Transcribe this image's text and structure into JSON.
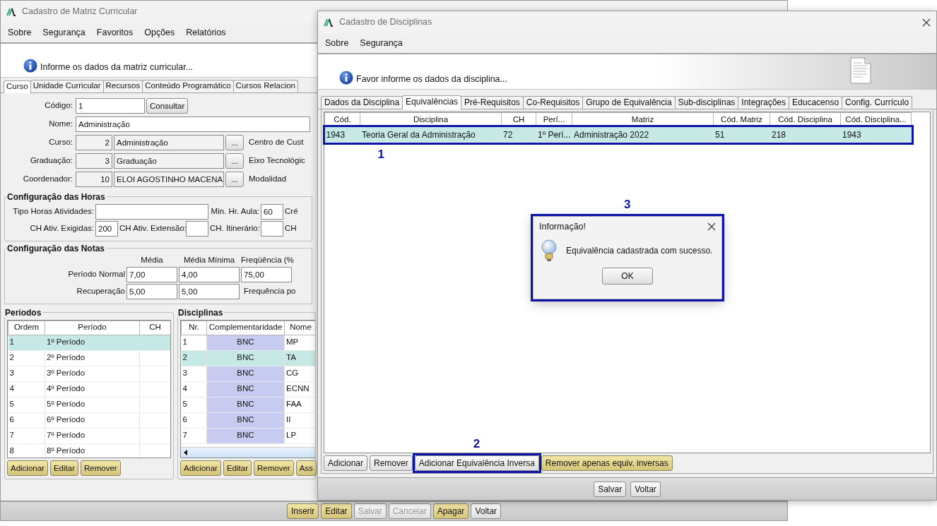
{
  "curriculum_window": {
    "title": "Cadastro de Matriz Curricular",
    "menu": [
      {
        "label": "Sobre"
      },
      {
        "label": "Segurança"
      },
      {
        "label": "Favoritos"
      },
      {
        "label": "Opções"
      },
      {
        "label": "Relatórios"
      }
    ],
    "info_message": "Informe os dados da matriz curricular...",
    "tabs": [
      {
        "label": "Curso",
        "selected": true
      },
      {
        "label": "Unidade Curricular",
        "selected": false
      },
      {
        "label": "Recursos",
        "selected": false
      },
      {
        "label": "Conteúdo Programático",
        "selected": false
      },
      {
        "label": "Cursos Relacion",
        "selected": false
      }
    ],
    "fields": [
      {
        "kind": "code",
        "label": "Código:",
        "value": "1",
        "button": {
          "label": "Consultar",
          "kind": "plain"
        }
      },
      {
        "kind": "text",
        "label": "Nome:",
        "value": "Administração"
      },
      {
        "kind": "lookup",
        "label": "Curso:",
        "code": "2",
        "value": "Administração",
        "button": {
          "label": "...",
          "kind": "plain"
        },
        "side_label": "Centro de Cust"
      },
      {
        "kind": "lookup",
        "label": "Graduação:",
        "code": "3",
        "value": "Graduação",
        "button": {
          "label": "...",
          "kind": "plain"
        },
        "side_label": "Eixo Tecnológic"
      },
      {
        "kind": "lookup",
        "label": "Coordenador:",
        "code": "10",
        "value": "ELOI AGOSTINHO MACENA",
        "button": {
          "label": "...",
          "kind": "plain"
        },
        "side_label": "Modalidad"
      }
    ],
    "hours": {
      "title": "Configuração das Horas",
      "items": [
        {
          "kind": "wide_field",
          "label": "Tipo Horas Atividades:"
        },
        {
          "kind": "field",
          "label": "Min. Hr. Aula:",
          "value": "60"
        },
        {
          "kind": "label",
          "label": "Cré"
        },
        {
          "kind": "field",
          "label": "CH Ativ. Exigidas:",
          "value": "200"
        },
        {
          "kind": "field",
          "label": "CH Ativ. Extensão:"
        },
        {
          "kind": "field",
          "label": "CH. Itinerário:"
        },
        {
          "kind": "label",
          "label": "CH"
        }
      ]
    },
    "grades": {
      "title": "Configuração das Notas",
      "columns": [
        "Média",
        "Média Mínima",
        "Freqüência (%"
      ],
      "rows": [
        {
          "label": "Período Normal",
          "values": [
            "7,00",
            "4,00",
            "75,00"
          ]
        },
        {
          "label": "Recuperação",
          "values": [
            "5,00",
            "5,00"
          ],
          "note": "Frequência po"
        }
      ]
    },
    "periods": {
      "title": "Períodos",
      "columns": [
        "Ordem",
        "Período",
        "CH"
      ],
      "rows": [
        {
          "cells": [
            "1",
            "1º Período"
          ],
          "selected": true
        },
        {
          "cells": [
            "2",
            "2º Período"
          ],
          "selected": false
        },
        {
          "cells": [
            "3",
            "3º Período"
          ],
          "selected": false
        },
        {
          "cells": [
            "4",
            "4º Período"
          ],
          "selected": false
        },
        {
          "cells": [
            "5",
            "5º Período"
          ],
          "selected": false
        },
        {
          "cells": [
            "6",
            "6º Período"
          ],
          "selected": false
        },
        {
          "cells": [
            "7",
            "7º Período"
          ],
          "selected": false
        },
        {
          "cells": [
            "8",
            "8º Período"
          ],
          "selected": false
        }
      ],
      "buttons": [
        {
          "label": "Adicionar",
          "kind": "accent"
        },
        {
          "label": "Editar",
          "kind": "accent"
        },
        {
          "label": "Remover",
          "kind": "accent"
        }
      ]
    },
    "disciplines": {
      "title": "Disciplinas",
      "columns": [
        "Nr.",
        "Complementaridade",
        "Nome"
      ],
      "rows": [
        {
          "cells": [
            "1",
            "BNC",
            "MP"
          ],
          "selected": false
        },
        {
          "cells": [
            "2",
            "BNC",
            "TA"
          ],
          "selected": true
        },
        {
          "cells": [
            "3",
            "BNC",
            "CG"
          ],
          "selected": false
        },
        {
          "cells": [
            "4",
            "BNC",
            "ECNN"
          ],
          "selected": false
        },
        {
          "cells": [
            "5",
            "BNC",
            "FAA"
          ],
          "selected": false
        },
        {
          "cells": [
            "6",
            "BNC",
            "II"
          ],
          "selected": false
        },
        {
          "cells": [
            "7",
            "BNC",
            "LP"
          ],
          "selected": false
        }
      ],
      "buttons": [
        {
          "label": "Adicionar",
          "kind": "accent"
        },
        {
          "label": "Editar",
          "kind": "accent"
        },
        {
          "label": "Remover",
          "kind": "accent"
        },
        {
          "label": "Ass",
          "kind": "accent"
        }
      ]
    },
    "bottom_buttons": [
      {
        "label": "Inserir",
        "kind": "accent",
        "disabled": false
      },
      {
        "label": "Editar",
        "kind": "accent",
        "disabled": false
      },
      {
        "label": "Salvar",
        "kind": "plain",
        "disabled": true
      },
      {
        "label": "Cancelar",
        "kind": "plain",
        "disabled": true
      },
      {
        "label": "Apagar",
        "kind": "accent",
        "disabled": false
      },
      {
        "label": "Voltar",
        "kind": "plain",
        "disabled": false
      }
    ]
  },
  "discipline_window": {
    "title": "Cadastro de Disciplinas",
    "menu": [
      {
        "label": "Sobre"
      },
      {
        "label": "Segurança"
      }
    ],
    "info_message": "Favor informe os dados da disciplina...",
    "tabs": [
      {
        "label": "Dados da Disciplina",
        "selected": false
      },
      {
        "label": "Equivalências",
        "selected": true
      },
      {
        "label": "Pré-Requisitos",
        "selected": false
      },
      {
        "label": "Co-Requisitos",
        "selected": false
      },
      {
        "label": "Grupo de Equivalência",
        "selected": false
      },
      {
        "label": "Sub-disciplinas",
        "selected": false
      },
      {
        "label": "Integrações",
        "selected": false
      },
      {
        "label": "Educacenso",
        "selected": false
      },
      {
        "label": "Config. Currículo",
        "selected": false
      }
    ],
    "table": {
      "columns": [
        "Cód.",
        "Disciplina",
        "CH",
        "Perí...",
        "Matriz",
        "Cód. Matriz",
        "Cód. Disciplina",
        "Cód. Disciplina..."
      ],
      "rows": [
        {
          "cells": [
            "1943",
            "Teoria Geral da Administração",
            "72",
            "1º Perí...",
            "Administração 2022",
            "51",
            "218",
            "1943"
          ],
          "selected": true,
          "annotation": "1"
        }
      ]
    },
    "buttons": [
      {
        "label": "Adicionar",
        "kind": "plain"
      },
      {
        "label": "Remover",
        "kind": "plain"
      },
      {
        "label": "Adicionar Equivalência Inversa",
        "kind": "plain",
        "annotation": "2"
      },
      {
        "label": "Remover apenas equiv. inversas",
        "kind": "accent"
      }
    ],
    "footer_buttons": [
      {
        "label": "Salvar",
        "kind": "plain"
      },
      {
        "label": "Voltar",
        "kind": "plain"
      }
    ]
  },
  "dialog": {
    "title": "Informação!",
    "message": "Equivalência cadastrada com sucesso.",
    "button": "OK",
    "annotation": "3"
  }
}
